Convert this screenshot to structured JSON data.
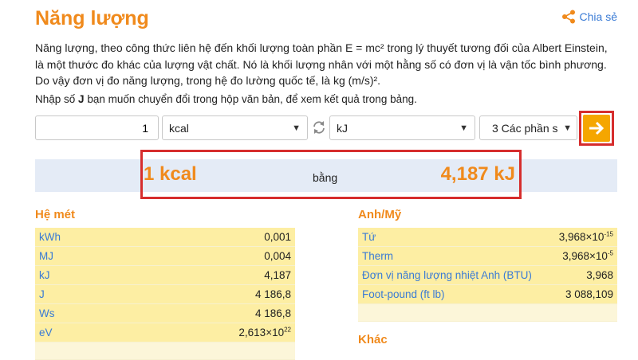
{
  "header": {
    "title": "Năng lượng",
    "share_label": "Chia sẻ"
  },
  "description": "Năng lượng, theo công thức liên hệ đến khối lượng toàn phần E = mc² trong lý thuyết tương đối của Albert Einstein, là một thước đo khác của lượng vật chất. Nó là khối lượng nhân với một hằng số có đơn vị là vận tốc bình phương. Do vậy đơn vị đo năng lượng, trong hệ đo lường quốc tế, là kg (m/s)².",
  "prompt": {
    "before": "Nhập số ",
    "bold": "J",
    "after": " bạn muốn chuyển đổi trong hộp văn bản, để xem kết quả trong bảng."
  },
  "converter": {
    "value": "1",
    "from_unit": "kcal",
    "to_unit": "kJ",
    "precision": "3 Các phần s"
  },
  "result": {
    "from": "1 kcal",
    "middle": "bằng",
    "to": "4,187 kJ"
  },
  "metric": {
    "title": "Hệ mét",
    "rows": [
      {
        "unit": "kWh",
        "value": "0,001"
      },
      {
        "unit": "MJ",
        "value": "0,004"
      },
      {
        "unit": "kJ",
        "value": "4,187"
      },
      {
        "unit": "J",
        "value": "4 186,8"
      },
      {
        "unit": "Ws",
        "value": "4 186,8"
      },
      {
        "unit": "eV",
        "value_base": "2,613×10",
        "value_exp": "22"
      }
    ]
  },
  "imperial": {
    "title": "Anh/Mỹ",
    "rows": [
      {
        "unit": "Tứ",
        "value_base": "3,968×10",
        "value_exp": "-15"
      },
      {
        "unit": "Therm",
        "value_base": "3,968×10",
        "value_exp": "-5"
      },
      {
        "unit": "Đơn vị năng lượng nhiệt Anh (BTU)",
        "value": "3,968"
      },
      {
        "unit": "Foot-pound (ft lb)",
        "value": "3 088,109"
      }
    ]
  },
  "other": {
    "title": "Khác"
  },
  "colors": {
    "accent_orange": "#f08a1c",
    "link_blue": "#3a7bd5",
    "highlight_red": "#d62d2d",
    "go_button": "#f5a600",
    "row_yellow": "#fdeea3"
  }
}
